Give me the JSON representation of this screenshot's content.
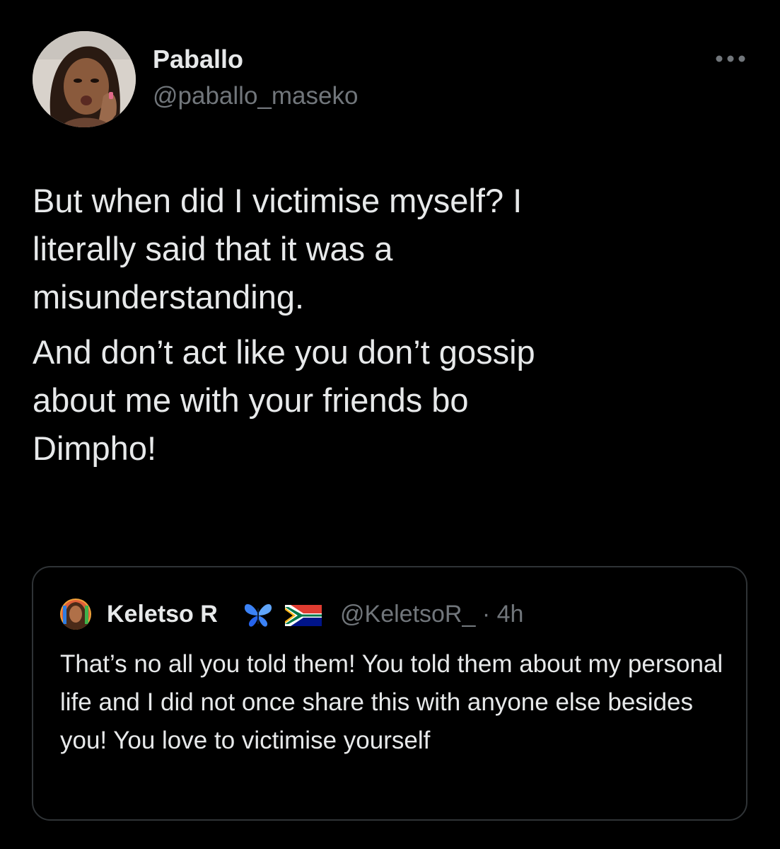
{
  "tweet": {
    "display_name": "Paballo",
    "handle": "@paballo_maseko",
    "more_label": "•••",
    "paragraphs": [
      "But when did I victimise myself? I\nliterally said that it was a\nmisunderstanding.",
      "And don’t act like you don’t gossip\nabout me with your friends bo\nDimpho!"
    ]
  },
  "quoted_tweet": {
    "display_name": "Keletso R",
    "handle_time": "@KeletsoR_ · 4h",
    "badge_icons": [
      "butterfly-icon",
      "south-africa-flag-icon"
    ],
    "text": "That’s no all you told them! You told them about my personal life and I did not once share this with anyone else besides you! You love to victimise yourself"
  },
  "colors": {
    "background": "#000000",
    "primary_text": "#e7e9ea",
    "secondary_text": "#71767b",
    "border": "#2f3336",
    "butterfly": "#3b82f6"
  }
}
